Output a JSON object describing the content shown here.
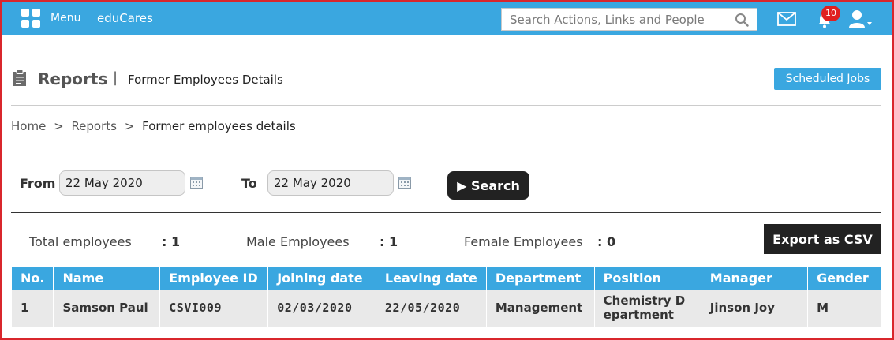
{
  "topbar": {
    "menu_label": "Menu",
    "brand": "eduCares",
    "search_placeholder": "Search Actions, Links and People",
    "notification_count": "10",
    "accent_color": "#3aa7e0"
  },
  "header": {
    "title": "Reports",
    "separator": "|",
    "subtitle": "Former Employees Details",
    "scheduled_jobs_label": "Scheduled Jobs"
  },
  "breadcrumb": {
    "items": [
      "Home",
      "Reports",
      "Former employees details"
    ],
    "separator": ">"
  },
  "filters": {
    "from_label": "From",
    "from_value": "22 May 2020",
    "to_label": "To",
    "to_value": "22 May 2020",
    "search_label": "Search",
    "search_icon": "play-icon"
  },
  "stats": {
    "total_label": "Total employees",
    "total_value": ": 1",
    "male_label": "Male Employees",
    "male_value": ": 1",
    "female_label": "Female Employees",
    "female_value": ": 0",
    "export_label": "Export as CSV"
  },
  "table": {
    "columns": [
      "No.",
      "Name",
      "Employee ID",
      "Joining date",
      "Leaving date",
      "Department",
      "Position",
      "Manager",
      "Gender"
    ],
    "rows": [
      [
        "1",
        "Samson Paul",
        "CSVI009",
        "02/03/2020",
        "22/05/2020",
        "Management",
        "Chemistry Department",
        "Jinson Joy",
        "M"
      ]
    ]
  },
  "icons": [
    "grid-menu-icon",
    "search-icon",
    "mail-icon",
    "bell-icon",
    "user-icon",
    "clipboard-icon",
    "calendar-icon"
  ]
}
